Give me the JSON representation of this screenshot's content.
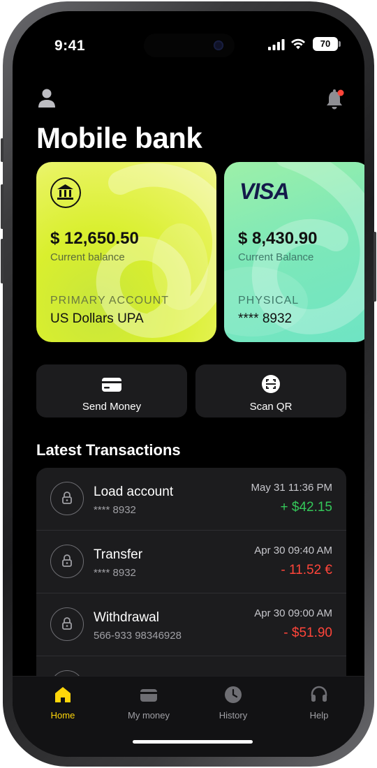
{
  "status_bar": {
    "time": "9:41",
    "battery": "70"
  },
  "header": {
    "title": "Mobile bank"
  },
  "cards": [
    {
      "balance": "$ 12,650.50",
      "balance_label": "Current balance",
      "account_label": "PRIMARY ACCOUNT",
      "account_name": "US Dollars UPA",
      "icon": "bank-icon"
    },
    {
      "brand": "VISA",
      "balance": "$ 8,430.90",
      "balance_label": "Current Balance",
      "account_label": "PHYSICAL",
      "account_name": "**** 8932",
      "icon": "visa-logo"
    }
  ],
  "actions": [
    {
      "label": "Send Money",
      "icon": "card-icon"
    },
    {
      "label": "Scan QR",
      "icon": "scan-qr-icon"
    }
  ],
  "transactions_title": "Latest Transactions",
  "transactions": [
    {
      "title": "Load account",
      "account": "**** 8932",
      "date": "May 31 11:36 PM",
      "amount": "+ $42.15",
      "kind": "credit"
    },
    {
      "title": "Transfer",
      "account": "**** 8932",
      "date": "Apr 30 09:40 AM",
      "amount": "- 11.52 €",
      "kind": "debit"
    },
    {
      "title": "Withdrawal",
      "account": "566-933 98346928",
      "date": "Apr 30 09:00 AM",
      "amount": "- $51.90",
      "kind": "debit"
    }
  ],
  "tabs": [
    {
      "label": "Home",
      "icon": "home-icon",
      "active": true
    },
    {
      "label": "My money",
      "icon": "wallet-icon",
      "active": false
    },
    {
      "label": "History",
      "icon": "clock-icon",
      "active": false
    },
    {
      "label": "Help",
      "icon": "headset-icon",
      "active": false
    }
  ],
  "colors": {
    "accent": "#FFD60A",
    "positive": "#34C759",
    "negative": "#FF453A",
    "card_primary": "#D9EF2E",
    "card_visa": "#7EE8B8"
  }
}
